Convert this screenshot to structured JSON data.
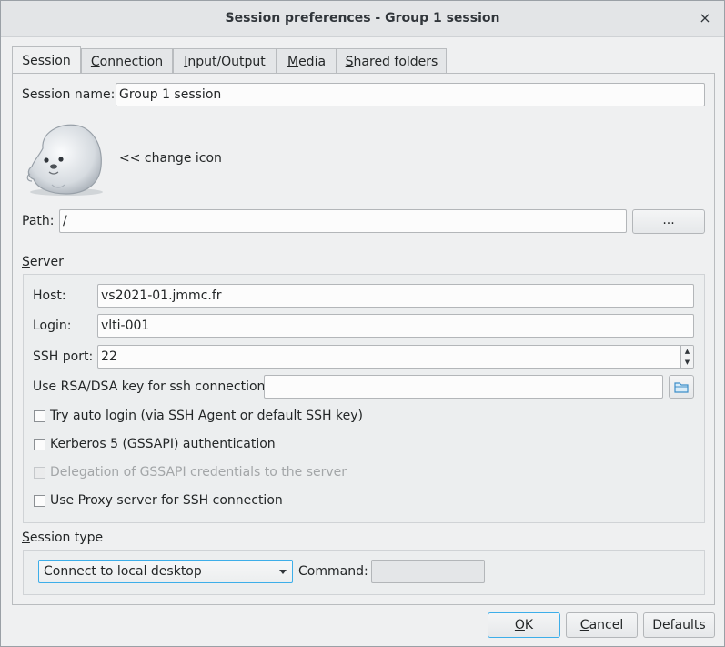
{
  "window": {
    "title": "Session preferences - Group 1 session",
    "close_glyph": "×"
  },
  "tabs": [
    {
      "label_u": "S",
      "label_rest": "ession"
    },
    {
      "label_u": "C",
      "label_rest": "onnection"
    },
    {
      "label_u": "I",
      "label_rest": "nput/Output"
    },
    {
      "label_u": "M",
      "label_rest": "edia"
    },
    {
      "label_u": "S",
      "label_rest": "hared folders"
    }
  ],
  "session": {
    "name_label": "Session name:",
    "name_value": "Group 1 session",
    "change_icon_label": "<< change icon",
    "icon": "seal-icon",
    "path_label": "Path:",
    "path_value": "/",
    "browse_label": "..."
  },
  "server": {
    "section_u": "S",
    "section_rest": "erver",
    "host_label": "Host:",
    "host_value": "vs2021-01.jmmc.fr",
    "login_label": "Login:",
    "login_value": "vlti-001",
    "port_label": "SSH port:",
    "port_value": "22",
    "key_label": "Use RSA/DSA key for ssh connection:",
    "key_value": "",
    "key_icon": "folder-icon",
    "checks": [
      {
        "label": "Try auto login (via SSH Agent or default SSH key)",
        "checked": false,
        "enabled": true
      },
      {
        "label": "Kerberos 5 (GSSAPI) authentication",
        "checked": false,
        "enabled": true
      },
      {
        "label": "Delegation of GSSAPI credentials to the server",
        "checked": false,
        "enabled": false
      },
      {
        "label": "Use Proxy server for SSH connection",
        "checked": false,
        "enabled": true
      }
    ]
  },
  "session_type": {
    "section_u": "S",
    "section_rest": "ession type",
    "selected": "Connect to local desktop",
    "command_label": "Command:",
    "command_value": ""
  },
  "buttons": {
    "ok_u": "O",
    "ok_rest": "K",
    "cancel_u": "C",
    "cancel_rest": "ancel",
    "defaults": "Defaults"
  },
  "colors": {
    "accent": "#3daee9",
    "background": "#eff0f1"
  }
}
